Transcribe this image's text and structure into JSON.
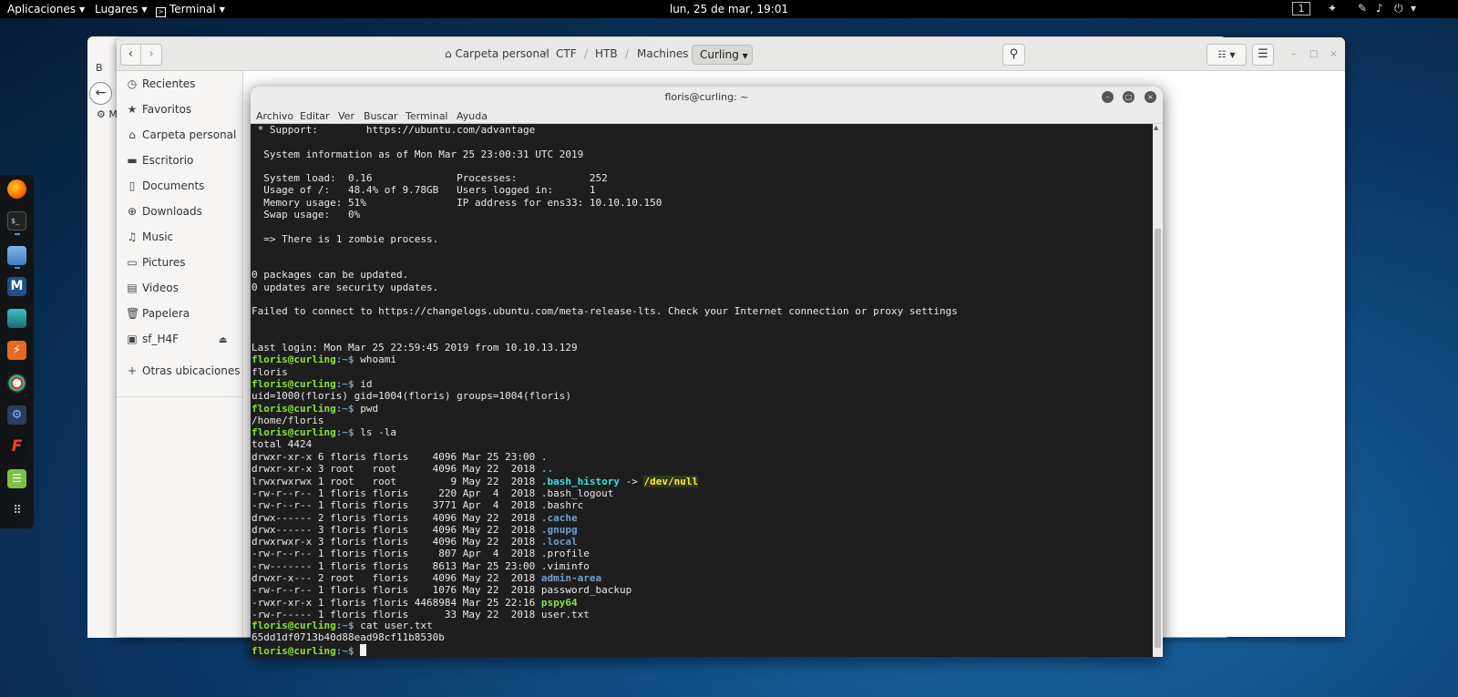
{
  "topbar": {
    "apps": "Aplicaciones",
    "places": "Lugares",
    "terminal": "Terminal",
    "clock": "lun, 25 de mar, 19:01",
    "workspace": "1"
  },
  "dock": {
    "apps": [
      "firefox",
      "terminal",
      "files",
      "metasploit",
      "armitage",
      "burpsuite",
      "cherrytree",
      "maltego",
      "faraday",
      "text-editor",
      "show-applications"
    ]
  },
  "files_window": {
    "back_label": "‹",
    "forward_label": "›",
    "breadcrumbs": [
      "Carpeta personal",
      "CTF",
      "HTB",
      "Machines"
    ],
    "current": "Curling",
    "sidebar": [
      {
        "label": "Recientes",
        "icon": "clock-icon"
      },
      {
        "label": "Favoritos",
        "icon": "star-icon"
      },
      {
        "label": "Carpeta personal",
        "icon": "home-icon"
      },
      {
        "label": "Escritorio",
        "icon": "desktop-icon"
      },
      {
        "label": "Documents",
        "icon": "document-icon"
      },
      {
        "label": "Downloads",
        "icon": "download-icon"
      },
      {
        "label": "Music",
        "icon": "music-icon"
      },
      {
        "label": "Pictures",
        "icon": "picture-icon"
      },
      {
        "label": "Videos",
        "icon": "video-icon"
      },
      {
        "label": "Papelera",
        "icon": "trash-icon"
      },
      {
        "label": "sf_H4F",
        "icon": "drive-icon"
      }
    ],
    "other_locations": "Otras ubicaciones",
    "bg_fragments": [
      "B",
      "M"
    ]
  },
  "terminal": {
    "title": "floris@curling: ~",
    "menu": [
      "Archivo",
      "Editar",
      "Ver",
      "Buscar",
      "Terminal",
      "Ayuda"
    ],
    "prompt_user": "floris@curling",
    "prompt_path": ":~$ ",
    "lines": {
      "support": " * Support:        https://ubuntu.com/advantage",
      "sysinfo": "  System information as of Mon Mar 25 23:00:31 UTC 2019",
      "load": "  System load:  0.16              Processes:            252",
      "usage": "  Usage of /:   48.4% of 9.78GB   Users logged in:      1",
      "memory": "  Memory usage: 51%               IP address for ens33: 10.10.10.150",
      "swap": "  Swap usage:   0%",
      "zombie": "  => There is 1 zombie process.",
      "packages": "0 packages can be updated.",
      "security": "0 updates are security updates.",
      "failed": "Failed to connect to https://changelogs.ubuntu.com/meta-release-lts. Check your Internet connection or proxy settings",
      "lastlogin": "Last login: Mon Mar 25 22:59:45 2019 from 10.10.13.129",
      "cmd_whoami": "whoami",
      "out_whoami": "floris",
      "cmd_id": "id",
      "out_id": "uid=1000(floris) gid=1004(floris) groups=1004(floris)",
      "cmd_pwd": "pwd",
      "out_pwd": "/home/floris",
      "cmd_ls": "ls -la",
      "out_total": "total 4424",
      "cmd_cat": "cat user.txt",
      "out_cat": "65dd1df0713b40d88ead98cf11b8530b"
    },
    "ls": [
      {
        "meta": "drwxr-xr-x 6 floris floris    4096 Mar 25 23:00 ",
        "name": ".",
        "kind": "plain"
      },
      {
        "meta": "drwxr-xr-x 3 root   root      4096 May 22  2018 ",
        "name": "..",
        "kind": "dir"
      },
      {
        "meta": "lrwxrwxrwx 1 root   root         9 May 22  2018 ",
        "name": ".bash_history",
        "kind": "link",
        "arrow": " -> ",
        "target": "/dev/null"
      },
      {
        "meta": "-rw-r--r-- 1 floris floris     220 Apr  4  2018 ",
        "name": ".bash_logout",
        "kind": "plain"
      },
      {
        "meta": "-rw-r--r-- 1 floris floris    3771 Apr  4  2018 ",
        "name": ".bashrc",
        "kind": "plain"
      },
      {
        "meta": "drwx------ 2 floris floris    4096 May 22  2018 ",
        "name": ".cache",
        "kind": "dir"
      },
      {
        "meta": "drwx------ 3 floris floris    4096 May 22  2018 ",
        "name": ".gnupg",
        "kind": "dir"
      },
      {
        "meta": "drwxrwxr-x 3 floris floris    4096 May 22  2018 ",
        "name": ".local",
        "kind": "dir"
      },
      {
        "meta": "-rw-r--r-- 1 floris floris     807 Apr  4  2018 ",
        "name": ".profile",
        "kind": "plain"
      },
      {
        "meta": "-rw------- 1 floris floris    8613 Mar 25 23:00 ",
        "name": ".viminfo",
        "kind": "plain"
      },
      {
        "meta": "drwxr-x--- 2 root   floris    4096 May 22  2018 ",
        "name": "admin-area",
        "kind": "dir"
      },
      {
        "meta": "-rw-r--r-- 1 floris floris    1076 May 22  2018 ",
        "name": "password_backup",
        "kind": "plain"
      },
      {
        "meta": "-rwxr-xr-x 1 floris floris 4468984 Mar 25 22:16 ",
        "name": "pspy64",
        "kind": "exe"
      },
      {
        "meta": "-rw-r----- 1 floris floris      33 May 22  2018 ",
        "name": "user.txt",
        "kind": "plain"
      }
    ]
  },
  "colors": {
    "prompt_user": "#8ae234",
    "prompt_path": "#729fcf",
    "directory": "#729fcf",
    "symlink": "#34e2e2",
    "symlink_target": "#fce94f",
    "executable": "#8ae234",
    "terminal_bg": "#1e1e1e"
  }
}
